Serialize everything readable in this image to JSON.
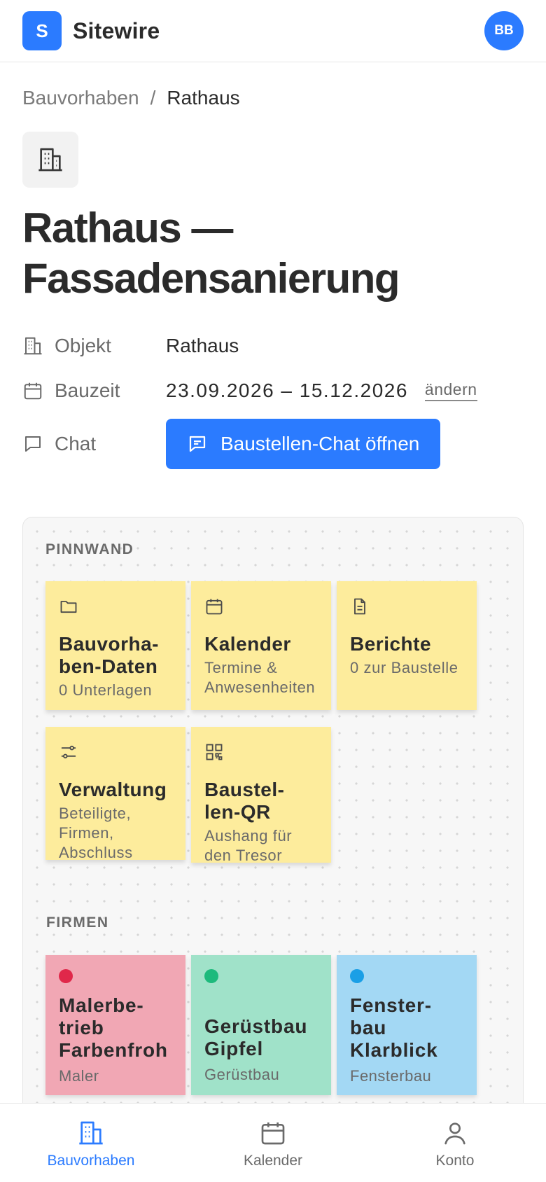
{
  "app": {
    "logo_letter": "S",
    "name": "Sitewire",
    "user_initials": "BB"
  },
  "breadcrumb": {
    "parent": "Bauvorhaben",
    "separator": "/",
    "current": "Rathaus"
  },
  "page": {
    "title": "Rathaus — Fassadensanierung"
  },
  "meta": {
    "object_label": "Objekt",
    "object_value": "Rathaus",
    "period_label": "Bauzeit",
    "period_value": "23.09.2026 – 15.12.2026",
    "change_link": "ändern",
    "chat_label": "Chat",
    "chat_button": "Baustellen-Chat öffnen"
  },
  "board": {
    "pinnwand_label": "PINNWAND",
    "notes": [
      {
        "icon": "folder-icon",
        "title": "Bauvorha-\nben-Daten",
        "subtitle": "0 Unterlagen"
      },
      {
        "icon": "calendar-icon",
        "title": "Kalender",
        "subtitle": "Termine & Anwesenheiten"
      },
      {
        "icon": "document-icon",
        "title": "Berichte",
        "subtitle": "0 zur Baustelle"
      },
      {
        "icon": "sliders-icon",
        "title": "Verwaltung",
        "subtitle": "Beteiligte, Firmen, Abschluss"
      },
      {
        "icon": "qr-code-icon",
        "title": "Baustel-\nlen-QR",
        "subtitle": "Aushang für den Tresor"
      }
    ],
    "firmen_label": "FIRMEN",
    "firms": [
      {
        "name": "Malerbe-\ntrieb Farbenfroh",
        "trade": "Maler",
        "bg": "#f1a7b4",
        "dot": "#e0284a"
      },
      {
        "name": "Gerüstbau Gipfel",
        "trade": "Gerüstbau",
        "bg": "#a0e2c9",
        "dot": "#1dba7c"
      },
      {
        "name": "Fenster-\nbau Klarblick",
        "trade": "Fensterbau",
        "bg": "#a3d8f4",
        "dot": "#1a9fe6"
      }
    ]
  },
  "nav": {
    "items": [
      {
        "label": "Bauvorhaben",
        "icon": "building-icon",
        "active": true
      },
      {
        "label": "Kalender",
        "icon": "calendar-icon",
        "active": false
      },
      {
        "label": "Konto",
        "icon": "user-icon",
        "active": false
      }
    ]
  },
  "colors": {
    "accent": "#2b7bff",
    "note_yellow": "#fdec9c"
  }
}
